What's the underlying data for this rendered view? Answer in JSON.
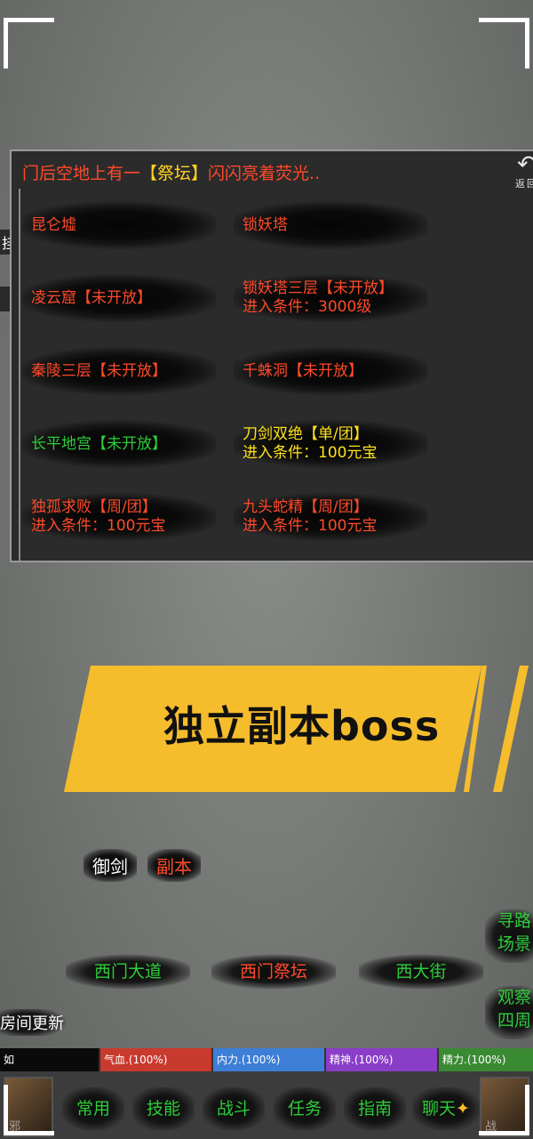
{
  "panel": {
    "title_prefix": "门后空地上有一",
    "title_highlight": "【祭坛】",
    "title_suffix": "闪闪亮着荧光..",
    "back_label": "返回",
    "entries": [
      {
        "line1": "昆仑墟",
        "line2": "",
        "color": "red"
      },
      {
        "line1": "锁妖塔",
        "line2": "",
        "color": "red"
      },
      {
        "line1": "凌云窟【未开放】",
        "line2": "",
        "color": "red"
      },
      {
        "line1": "锁妖塔三层【未开放】",
        "line2": "进入条件：3000级",
        "color": "red"
      },
      {
        "line1": "秦陵三层【未开放】",
        "line2": "",
        "color": "red"
      },
      {
        "line1": "千蛛洞【未开放】",
        "line2": "",
        "color": "red"
      },
      {
        "line1": "长平地宫【未开放】",
        "line2": "",
        "color": "green"
      },
      {
        "line1": "刀剑双绝【单/团】",
        "line2": "进入条件：100元宝",
        "color": "yellow"
      },
      {
        "line1": "独孤求败【周/团】",
        "line2": "进入条件：100元宝",
        "color": "red"
      },
      {
        "line1": "九头蛇精【周/团】",
        "line2": "进入条件：100元宝",
        "color": "red"
      }
    ]
  },
  "side_fragments": [
    "挂",
    "【"
  ],
  "banner": {
    "text": "独立副本boss"
  },
  "actions": {
    "yujian": "御剑",
    "fuben": "副本"
  },
  "locations": {
    "west_road": "西门大道",
    "west_altar": "西门祭坛",
    "west_street": "西大街"
  },
  "side_buttons": {
    "pathfind_1": "寻路",
    "pathfind_2": "场景",
    "observe_1": "观察",
    "observe_2": "四周"
  },
  "room_update": "房间更新",
  "stats": {
    "name": "如",
    "hp": "气血.(100%)",
    "mp": "内力.(100%)",
    "spirit": "精神.(100%)",
    "energy": "精力.(100%)"
  },
  "nav": {
    "common": "常用",
    "skills": "技能",
    "battle": "战斗",
    "tasks": "任务",
    "guide": "指南",
    "chat": "聊天"
  },
  "portraits": {
    "left": "邪",
    "right": "战"
  },
  "colors": {
    "banner": "#f5bd2c",
    "red_text": "#ff4a2a",
    "green_text": "#2ecc3a",
    "yellow_text": "#ffe21a"
  }
}
